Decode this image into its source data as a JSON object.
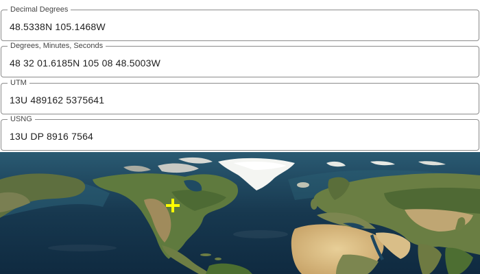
{
  "coordinate_fields": [
    {
      "label": "Decimal Degrees",
      "value": "48.5338N 105.1468W"
    },
    {
      "label": "Degrees, Minutes, Seconds",
      "value": "48 32 01.6185N 105 08 48.5003W"
    },
    {
      "label": "UTM",
      "value": "13U 489162 5375641"
    },
    {
      "label": "USNG",
      "value": "13U DP 8916 7564"
    }
  ],
  "map": {
    "basemap": "satellite imagery",
    "marker_icon": "crosshair-plus-icon",
    "marker_color": "#ffff00",
    "ocean_color": "#16324a"
  }
}
